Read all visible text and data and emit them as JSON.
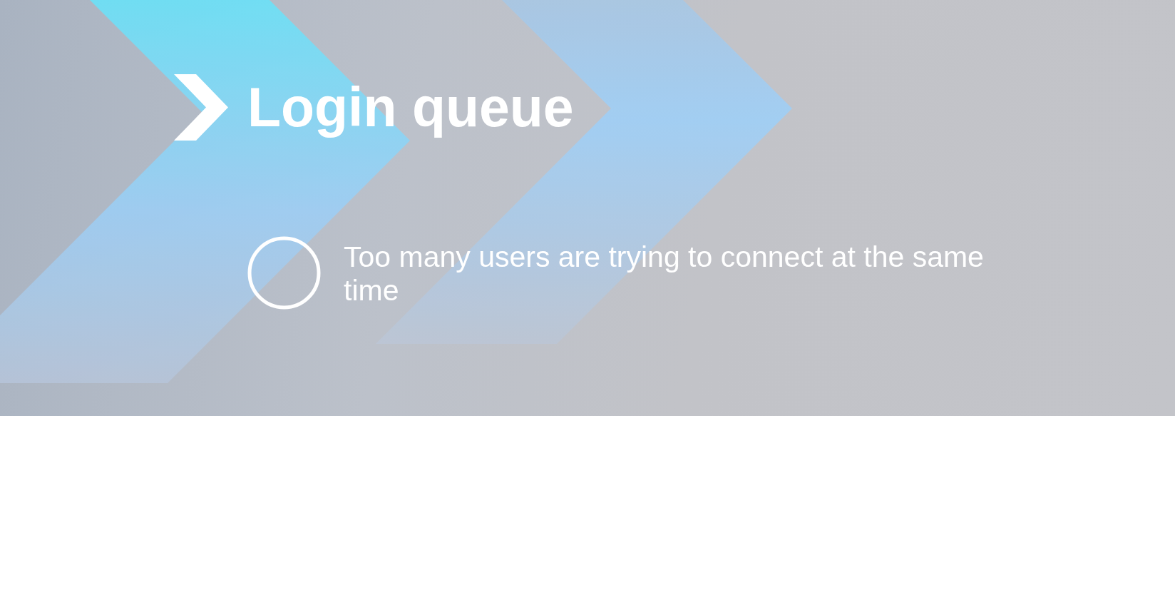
{
  "header": {
    "title": "Login queue"
  },
  "message": {
    "text": "Too many users are trying to connect at the same time"
  }
}
